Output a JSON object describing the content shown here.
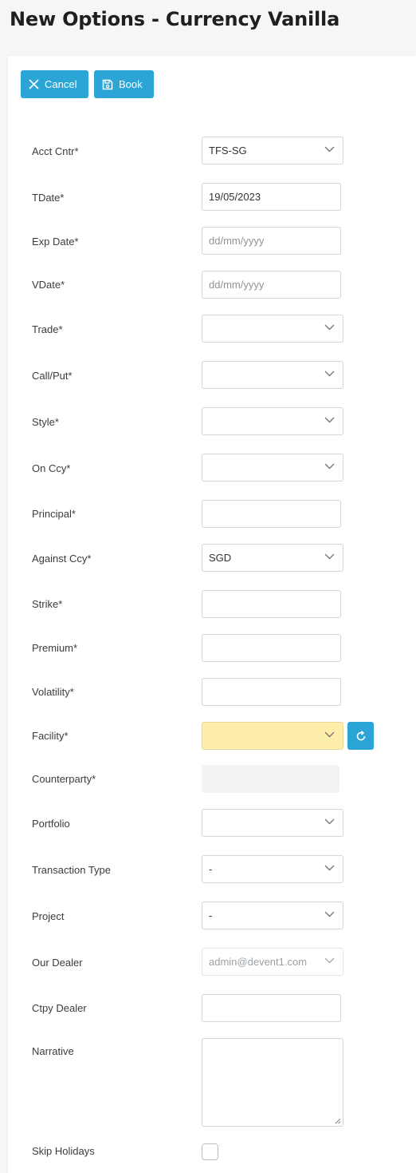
{
  "page": {
    "title": "New Options - Currency Vanilla"
  },
  "toolbar": {
    "cancel_label": "Cancel",
    "book_label": "Book"
  },
  "form": {
    "acct_cntr": {
      "label": "Acct Cntr*",
      "value": "TFS-SG"
    },
    "tdate": {
      "label": "TDate*",
      "value": "19/05/2023"
    },
    "exp_date": {
      "label": "Exp Date*",
      "placeholder": "dd/mm/yyyy"
    },
    "vdate": {
      "label": "VDate*",
      "placeholder": "dd/mm/yyyy"
    },
    "trade": {
      "label": "Trade*",
      "value": ""
    },
    "call_put": {
      "label": "Call/Put*",
      "value": ""
    },
    "style": {
      "label": "Style*",
      "value": ""
    },
    "on_ccy": {
      "label": "On Ccy*",
      "value": ""
    },
    "principal": {
      "label": "Principal*",
      "value": ""
    },
    "against_ccy": {
      "label": "Against Ccy*",
      "value": "SGD"
    },
    "strike": {
      "label": "Strike*",
      "value": ""
    },
    "premium": {
      "label": "Premium*",
      "value": ""
    },
    "volatility": {
      "label": "Volatility*",
      "value": ""
    },
    "facility": {
      "label": "Facility*",
      "value": ""
    },
    "counterparty": {
      "label": "Counterparty*",
      "value": ""
    },
    "portfolio": {
      "label": "Portfolio",
      "value": ""
    },
    "transaction_type": {
      "label": "Transaction Type",
      "value": "-"
    },
    "project": {
      "label": "Project",
      "value": "-"
    },
    "our_dealer": {
      "label": "Our Dealer",
      "value": "admin@devent1.com"
    },
    "ctpy_dealer": {
      "label": "Ctpy Dealer",
      "value": ""
    },
    "narrative": {
      "label": "Narrative",
      "value": ""
    },
    "skip_holidays": {
      "label": "Skip Holidays",
      "checked": false
    }
  },
  "colors": {
    "accent": "#2aa5d6",
    "facility_highlight": "#fdeeaa",
    "disabled_bg": "#f3f3f3"
  },
  "icons": [
    "close-icon",
    "save-icon",
    "chevron-down-icon",
    "refresh-icon"
  ]
}
